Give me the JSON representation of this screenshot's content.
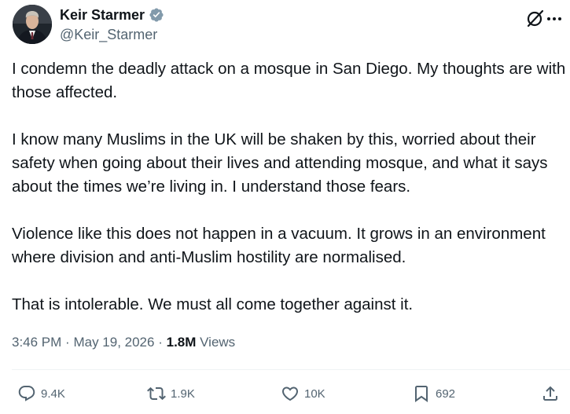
{
  "author": {
    "display_name": "Keir Starmer",
    "handle": "@Keir_Starmer",
    "verified": true,
    "verified_color": "#829aab"
  },
  "icons": {
    "grok": "grok-icon",
    "more": "more-icon",
    "reply": "reply-icon",
    "repost": "repost-icon",
    "like": "like-icon",
    "bookmark": "bookmark-icon",
    "share": "share-icon"
  },
  "tweet": {
    "paragraphs": [
      "I condemn the deadly attack on a mosque in San Diego. My thoughts are with those affected.",
      "I know many Muslims in the UK will be shaken by this, worried about their safety when going about their lives and attending mosque, and what it says about the times we’re living in. I understand those fears.",
      "Violence like this does not happen in a vacuum. It grows in an environment where division and anti-Muslim hostility are normalised.",
      "That is intolerable. We must all come together against it."
    ],
    "time": "3:46 PM",
    "separator": "·",
    "date": "May 19, 2026",
    "views_count": "1.8M",
    "views_label": "Views"
  },
  "actions": {
    "replies": "9.4K",
    "reposts": "1.9K",
    "likes": "10K",
    "bookmarks": "692"
  },
  "colors": {
    "text_primary": "#0f1419",
    "text_secondary": "#536471",
    "divider": "#eff3f4"
  }
}
